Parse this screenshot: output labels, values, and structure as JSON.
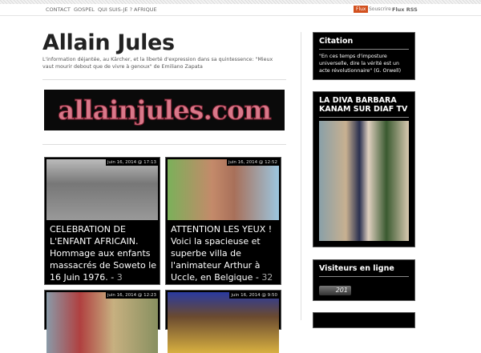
{
  "nav": {
    "items": [
      "CONTACT",
      "GOSPEL",
      "QUI SUIS-JE ?",
      "AFRIQUE"
    ],
    "flux_badge": "Flux",
    "subscribe": "Souscrire :",
    "rss": "Flux RSS"
  },
  "site": {
    "title": "Allain Jules",
    "tagline": "L'information déjantée, au Kärcher, et la liberté d'expression dans sa quintessence: \"Mieux vaut mourir debout que de vivre à genoux\" de Emiliano Zapata",
    "logo": "allainjules.com"
  },
  "posts": [
    {
      "date": "juin 16, 2014 @ 17:13",
      "title": "CELEBRATION DE L'ENFANT AFRICAIN. Hommage aux enfants massacrés de Soweto le 16 Juin 1976.",
      "count": "3"
    },
    {
      "date": "juin 16, 2014 @ 12:52",
      "title": "ATTENTION LES YEUX ! Voici la spacieuse et superbe villa de l'animateur Arthur à Uccle, en Belgique",
      "count": "32"
    },
    {
      "date": "juin 16, 2014 @ 12:23"
    },
    {
      "date": "juin 16, 2014 @ 9:50"
    }
  ],
  "sidebar": {
    "citation_title": "Citation",
    "citation_text": "\"En ces temps d'imposture universelle, dire la vérité est un acte révolutionnaire\" (G. Orwell)",
    "diva_title": "LA DIVA BARBARA KANAM SUR DIAF TV",
    "visitors_title": "Visiteurs en ligne",
    "visitors_count": "201"
  }
}
